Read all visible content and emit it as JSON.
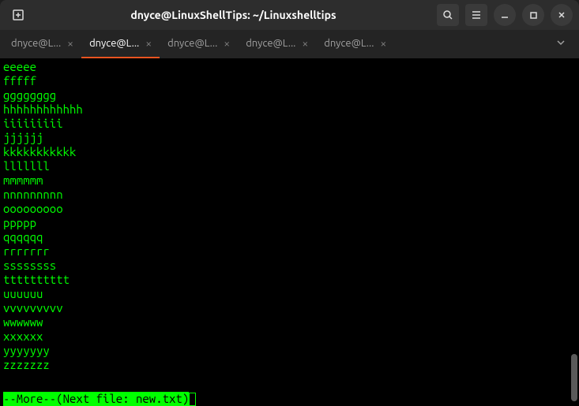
{
  "titlebar": {
    "title": "dnyce@LinuxShellTips: ~/Linuxshelltips"
  },
  "tabs": [
    {
      "label": "dnyce@L...",
      "active": false
    },
    {
      "label": "dnyce@L...",
      "active": true
    },
    {
      "label": "dnyce@L...",
      "active": false
    },
    {
      "label": "dnyce@L...",
      "active": false
    },
    {
      "label": "dnyce@L...",
      "active": false
    }
  ],
  "terminal": {
    "lines": [
      "eeeee",
      "fffff",
      "gggggggg",
      "hhhhhhhhhhhh",
      "iiiiiiiii",
      "jjjjjj",
      "kkkkkkkkkkk",
      "lllllll",
      "mmmmmm",
      "nnnnnnnnn",
      "ooooooooo",
      "ppppp",
      "qqqqqq",
      "rrrrrrr",
      "ssssssss",
      "tttttttttt",
      "uuuuuu",
      "vvvvvvvvv",
      "wwwwww",
      "xxxxxx",
      "yyyyyyy",
      "zzzzzzz"
    ],
    "status": "--More--(Next file: new.txt)"
  }
}
